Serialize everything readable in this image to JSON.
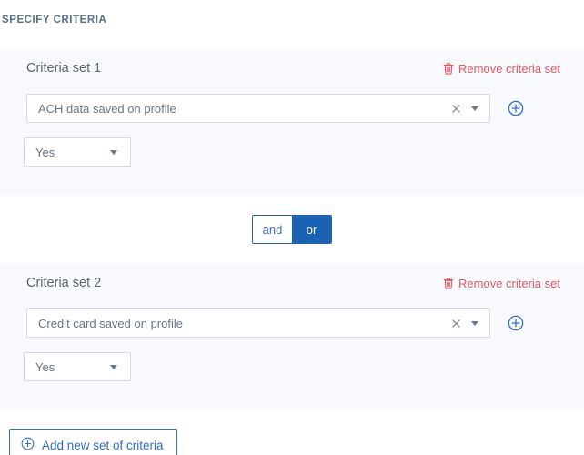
{
  "section": {
    "heading": "SPECIFY CRITERIA"
  },
  "colors": {
    "panel_background": "#f8f9fd",
    "accent_blue": "#1a62b3",
    "link_blue": "#2f6fc4",
    "remove_red": "#e8545f",
    "field_border": "#d6dbe3",
    "heading_text": "#596d84",
    "body_text": "#6b7480"
  },
  "criteria_sets": [
    {
      "title": "Criteria set 1",
      "remove_label": "Remove criteria set",
      "remove_icon": "trash-icon",
      "criterion": {
        "value": "ACH data saved on profile",
        "clear_icon": "close-icon",
        "caret_icon": "chevron-down-icon"
      },
      "add_criterion_icon": "circle-plus-icon",
      "answer": {
        "value": "Yes",
        "caret_icon": "chevron-down-icon"
      }
    },
    {
      "title": "Criteria set 2",
      "remove_label": "Remove criteria set",
      "remove_icon": "trash-icon",
      "criterion": {
        "value": "Credit card saved on profile",
        "clear_icon": "close-icon",
        "caret_icon": "chevron-down-icon"
      },
      "add_criterion_icon": "circle-plus-icon",
      "answer": {
        "value": "Yes",
        "caret_icon": "chevron-down-icon"
      }
    }
  ],
  "logic_toggle": {
    "options": [
      {
        "label": "and",
        "selected": false
      },
      {
        "label": "or",
        "selected": true
      }
    ]
  },
  "add_set_button": {
    "label": "Add new set of criteria",
    "icon": "circle-plus-icon"
  }
}
